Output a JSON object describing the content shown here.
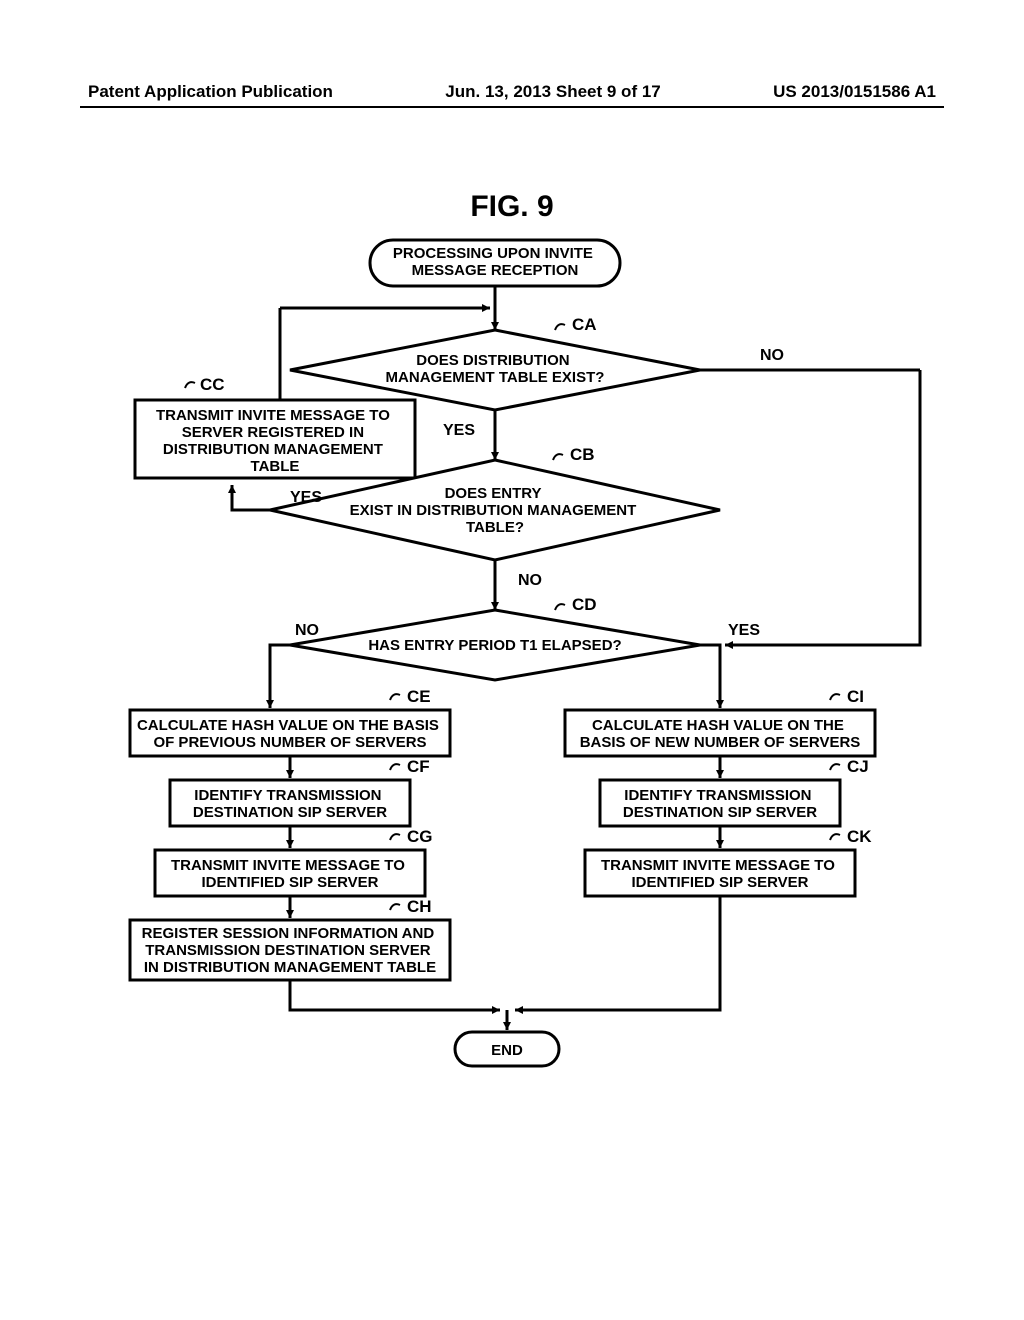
{
  "header": {
    "left": "Patent Application Publication",
    "center": "Jun. 13, 2013  Sheet 9 of 17",
    "right": "US 2013/0151586 A1"
  },
  "figure_title": "FIG. 9",
  "nodes": {
    "start": "PROCESSING UPON INVITE\nMESSAGE RECEPTION",
    "CA": "DOES DISTRIBUTION\nMANAGEMENT TABLE EXIST?",
    "CB": "DOES ENTRY\nEXIST IN DISTRIBUTION MANAGEMENT\nTABLE?",
    "CC": "TRANSMIT INVITE MESSAGE TO\nSERVER REGISTERED IN\nDISTRIBUTION MANAGEMENT\nTABLE",
    "CD": "HAS ENTRY PERIOD T1 ELAPSED?",
    "CE": "CALCULATE HASH VALUE ON THE BASIS\nOF PREVIOUS NUMBER OF SERVERS",
    "CF": "IDENTIFY TRANSMISSION\nDESTINATION SIP SERVER",
    "CG": "TRANSMIT INVITE MESSAGE TO\nIDENTIFIED SIP SERVER",
    "CH": "REGISTER SESSION INFORMATION AND\nTRANSMISSION DESTINATION SERVER\nIN DISTRIBUTION MANAGEMENT TABLE",
    "CI": "CALCULATE HASH VALUE ON THE\nBASIS OF NEW NUMBER OF SERVERS",
    "CJ": "IDENTIFY TRANSMISSION\nDESTINATION SIP SERVER",
    "CK": "TRANSMIT INVITE MESSAGE TO\nIDENTIFIED SIP SERVER",
    "end": "END"
  },
  "refs": {
    "CA": "CA",
    "CB": "CB",
    "CC": "CC",
    "CD": "CD",
    "CE": "CE",
    "CF": "CF",
    "CG": "CG",
    "CH": "CH",
    "CI": "CI",
    "CJ": "CJ",
    "CK": "CK"
  },
  "edge_labels": {
    "yes": "YES",
    "no": "NO"
  }
}
